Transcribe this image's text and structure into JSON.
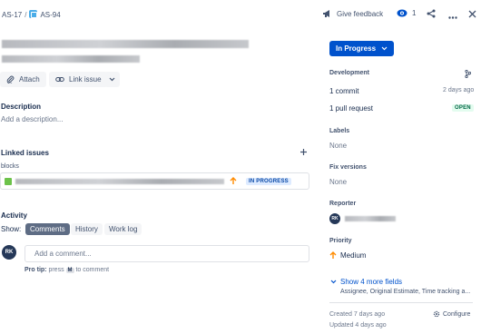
{
  "breadcrumb": {
    "parent": "AS-17",
    "separator": "/",
    "current": "AS-94"
  },
  "topbar": {
    "feedback_label": "Give feedback",
    "watch_count": "1"
  },
  "actions": {
    "attach": "Attach",
    "link_issue": "Link issue"
  },
  "description": {
    "title": "Description",
    "placeholder": "Add a description..."
  },
  "linked_issues": {
    "title": "Linked issues",
    "relation": "blocks",
    "status": "IN PROGRESS"
  },
  "activity": {
    "title": "Activity",
    "show_label": "Show:",
    "tabs": [
      "Comments",
      "History",
      "Work log"
    ],
    "active_tab": "Comments",
    "avatar_initials": "RK",
    "comment_placeholder": "Add a comment...",
    "tip_bold": "Pro tip:",
    "tip_press": "press",
    "tip_key": "M",
    "tip_rest": "to comment"
  },
  "sidebar": {
    "status": "In Progress",
    "development": {
      "title": "Development",
      "commit": "1 commit",
      "commit_time": "2 days ago",
      "pull_request": "1 pull request",
      "pr_status": "OPEN"
    },
    "labels": {
      "title": "Labels",
      "value": "None"
    },
    "fix_versions": {
      "title": "Fix versions",
      "value": "None"
    },
    "reporter": {
      "title": "Reporter",
      "initials": "RK"
    },
    "priority": {
      "title": "Priority",
      "value": "Medium"
    },
    "more_fields": {
      "label": "Show 4 more fields",
      "sub": "Assignee, Original Estimate, Time tracking a..."
    },
    "created": "Created 7 days ago",
    "updated": "Updated 4 days ago",
    "configure": "Configure"
  },
  "colors": {
    "accent": "#0052cc",
    "priority_medium": "#ff8b00",
    "text": "#172b4d"
  }
}
